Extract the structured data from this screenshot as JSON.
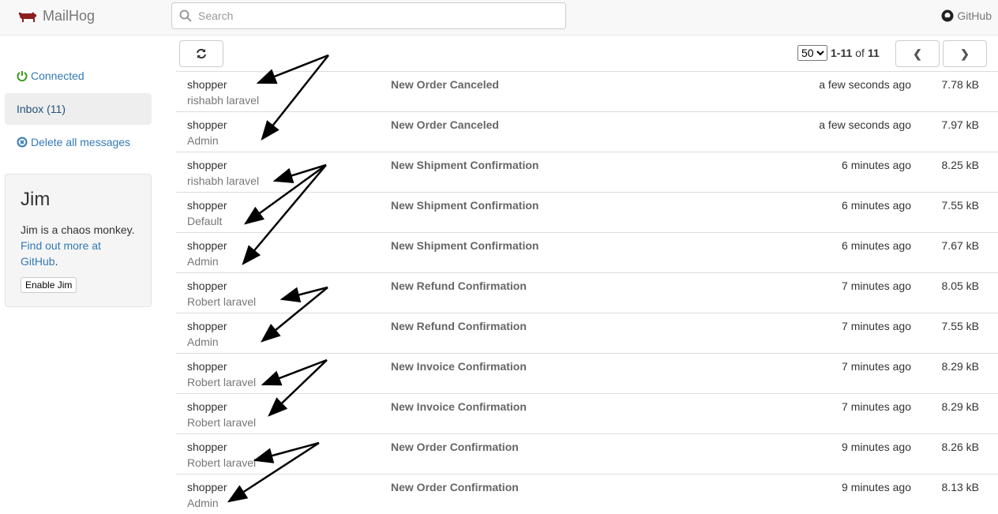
{
  "nav": {
    "brand": "MailHog",
    "search_placeholder": "Search",
    "github": "GitHub"
  },
  "sidebar": {
    "connected": "Connected",
    "inbox": "Inbox (11)",
    "delete_all": "Delete all messages"
  },
  "jim": {
    "title": "Jim",
    "text": "Jim is a chaos monkey.",
    "link": "Find out more at GitHub",
    "period": ".",
    "button": "Enable Jim"
  },
  "toolbar": {
    "page_size": "50",
    "range": "1-11",
    "of": "of",
    "total": "11"
  },
  "messages": [
    {
      "from": "shopper",
      "to": "rishabh laravel",
      "subject": "New Order Canceled",
      "time": "a few seconds ago",
      "size": "7.78 kB"
    },
    {
      "from": "shopper",
      "to": "Admin",
      "subject": "New Order Canceled",
      "time": "a few seconds ago",
      "size": "7.97 kB"
    },
    {
      "from": "shopper",
      "to": "rishabh laravel",
      "subject": "New Shipment Confirmation",
      "time": "6 minutes ago",
      "size": "8.25 kB"
    },
    {
      "from": "shopper",
      "to": "Default",
      "subject": "New Shipment Confirmation",
      "time": "6 minutes ago",
      "size": "7.55 kB"
    },
    {
      "from": "shopper",
      "to": "Admin",
      "subject": "New Shipment Confirmation",
      "time": "6 minutes ago",
      "size": "7.67 kB"
    },
    {
      "from": "shopper",
      "to": "Robert laravel",
      "subject": "New Refund Confirmation",
      "time": "7 minutes ago",
      "size": "8.05 kB"
    },
    {
      "from": "shopper",
      "to": "Admin",
      "subject": "New Refund Confirmation",
      "time": "7 minutes ago",
      "size": "7.55 kB"
    },
    {
      "from": "shopper",
      "to": "Robert laravel",
      "subject": "New Invoice Confirmation",
      "time": "7 minutes ago",
      "size": "8.29 kB"
    },
    {
      "from": "shopper",
      "to": "Robert laravel",
      "subject": "New Invoice Confirmation",
      "time": "7 minutes ago",
      "size": "8.29 kB"
    },
    {
      "from": "shopper",
      "to": "Robert laravel",
      "subject": "New Order Confirmation",
      "time": "9 minutes ago",
      "size": "8.26 kB"
    },
    {
      "from": "shopper",
      "to": "Admin",
      "subject": "New Order Confirmation",
      "time": "9 minutes ago",
      "size": "8.13 kB"
    }
  ]
}
